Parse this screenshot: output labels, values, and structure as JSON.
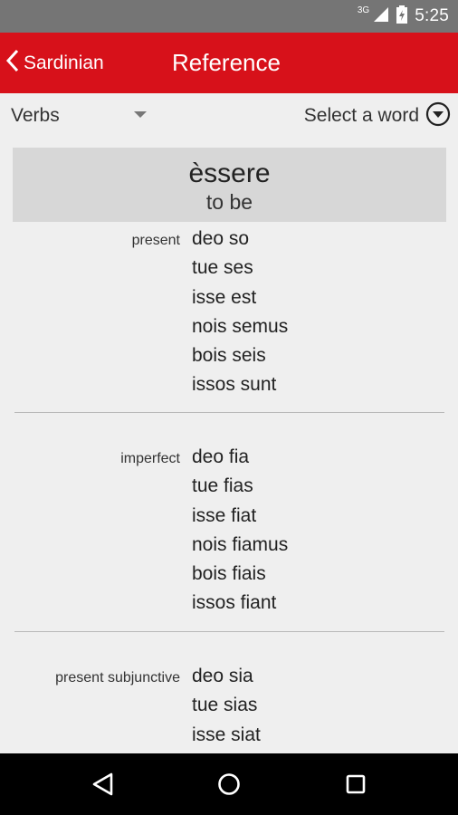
{
  "status_bar": {
    "network": "3G",
    "time": "5:25"
  },
  "app_bar": {
    "back_label": "Sardinian",
    "title": "Reference"
  },
  "toolbar": {
    "category": "Verbs",
    "word_select": "Select a word"
  },
  "entry": {
    "word": "èssere",
    "translation": "to be",
    "tenses": [
      {
        "label": "present",
        "forms": [
          "deo so",
          "tue ses",
          "isse est",
          "nois semus",
          "bois seis",
          "issos sunt"
        ]
      },
      {
        "label": "imperfect",
        "forms": [
          "deo fia",
          "tue fias",
          "isse fiat",
          "nois fiamus",
          "bois fiais",
          "issos fiant"
        ]
      },
      {
        "label": "present subjunctive",
        "forms": [
          "deo sia",
          "tue sias",
          "isse siat"
        ]
      }
    ]
  },
  "colors": {
    "accent": "#d7111a",
    "status_bar": "#757575",
    "background": "#efefef",
    "header_bg": "#d7d7d7"
  }
}
